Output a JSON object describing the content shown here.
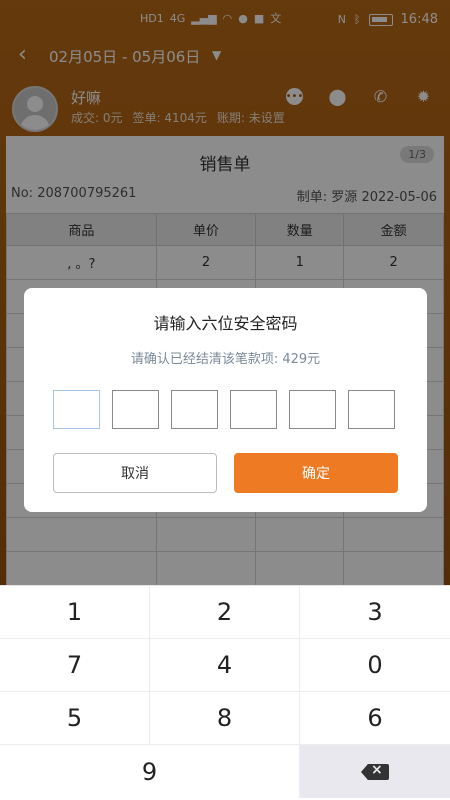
{
  "status_bar": {
    "left_icons": [
      "HD1",
      "HD2",
      "4G",
      "4G",
      "wifi",
      "wechat",
      "qq",
      "translate"
    ],
    "right_icons": [
      "nfc",
      "bluetooth",
      "battery"
    ],
    "time": "16:48"
  },
  "header": {
    "date_range": "02月05日 - 05月06日"
  },
  "customer": {
    "name": "好嘛",
    "deals": "成交: 0元",
    "orders": "签单: 4104元",
    "term": "账期: 未设置"
  },
  "sales_order": {
    "title": "销售单",
    "page_badge": "1/3",
    "order_no": "No: 208700795261",
    "creator": "制单: 罗源  2022-05-06",
    "columns": [
      "商品",
      "单价",
      "数量",
      "金额"
    ],
    "rows": [
      [
        ", 。?",
        "2",
        "1",
        "2"
      ]
    ]
  },
  "dialog": {
    "title": "请输入六位安全密码",
    "message": "请确认已经结清该笔款项: 429元",
    "cancel": "取消",
    "confirm": "确定"
  },
  "keypad": {
    "keys": [
      "1",
      "2",
      "3",
      "7",
      "4",
      "0",
      "5",
      "8",
      "6",
      "9"
    ],
    "delete_icon": "backspace-icon"
  },
  "colors": {
    "header_orange": "#a85e12",
    "confirm_orange": "#ee7a23"
  }
}
